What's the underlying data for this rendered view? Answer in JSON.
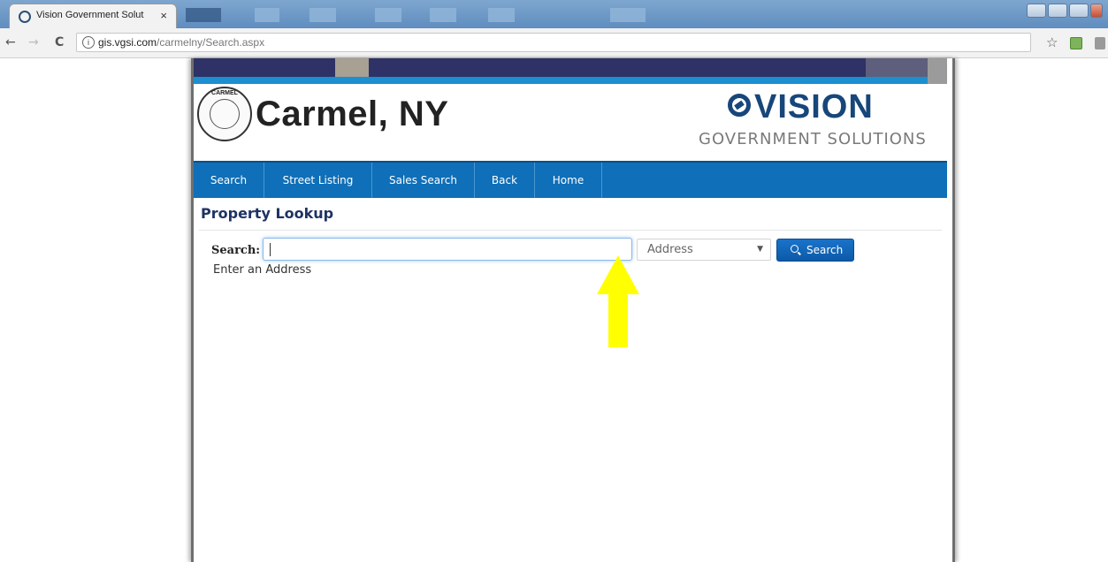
{
  "browser": {
    "tab_title": "Vision Government Solut",
    "tab_close": "×",
    "url_host": "gis.vgsi.com",
    "url_path": "/carmelny/Search.aspx",
    "nav": {
      "back": "←",
      "forward": "→",
      "reload": "C"
    },
    "info_glyph": "i",
    "star_glyph": "☆"
  },
  "header": {
    "town_name": "Carmel, NY",
    "seal_text": "CARMEL",
    "vendor_name": "VISION",
    "vendor_sub": "GOVERNMENT SOLUTIONS"
  },
  "nav": {
    "items": [
      {
        "label": "Search"
      },
      {
        "label": "Street Listing"
      },
      {
        "label": "Sales Search"
      },
      {
        "label": "Back"
      },
      {
        "label": "Home"
      }
    ]
  },
  "content": {
    "section_title": "Property Lookup",
    "search_label": "Search:",
    "search_value": "",
    "search_type_selected": "Address",
    "search_button_label": "Search",
    "hint": "Enter an Address"
  },
  "colors": {
    "nav_bg": "#0f6fb8",
    "banner": "#2f3266",
    "stripe": "#1b8fd0",
    "vision_blue": "#17467a",
    "annotation_arrow": "#ffff00"
  },
  "icons": {
    "search_button_icon": "magnifier-icon",
    "select_icon": "chevron-down-icon",
    "annotation": "arrow-up-icon"
  }
}
